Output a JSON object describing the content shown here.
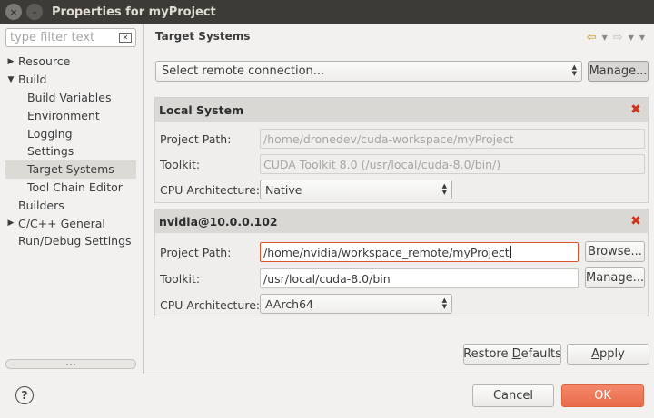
{
  "window": {
    "title": "Properties for myProject"
  },
  "filter": {
    "placeholder": "type filter text"
  },
  "tree": {
    "resource": "Resource",
    "build": "Build",
    "build_variables": "Build Variables",
    "environment": "Environment",
    "logging": "Logging",
    "settings": "Settings",
    "target_systems": "Target Systems",
    "tool_chain_editor": "Tool Chain Editor",
    "builders": "Builders",
    "cpp_general": "C/C++ General",
    "run_debug": "Run/Debug Settings"
  },
  "page": {
    "title": "Target Systems"
  },
  "remote": {
    "select_label": "Select remote connection...",
    "manage_label": "Manage..."
  },
  "local": {
    "header": "Local System",
    "project_path_label": "Project Path:",
    "project_path_value": "/home/dronedev/cuda-workspace/myProject",
    "toolkit_label": "Toolkit:",
    "toolkit_value": "CUDA Toolkit 8.0 (/usr/local/cuda-8.0/bin/)",
    "cpu_label": "CPU Architecture:",
    "cpu_value": "Native"
  },
  "remote_system": {
    "header": "nvidia@10.0.0.102",
    "project_path_label": "Project Path:",
    "project_path_value": "/home/nvidia/workspace_remote/myProject",
    "browse_label": "Browse...",
    "toolkit_label": "Toolkit:",
    "toolkit_value": "/usr/local/cuda-8.0/bin",
    "manage_label": "Manage...",
    "cpu_label": "CPU Architecture:",
    "cpu_value": "AArch64"
  },
  "actions": {
    "restore_defaults_pre": "Restore ",
    "restore_defaults_mnemonic": "D",
    "restore_defaults_post": "efaults",
    "apply_mnemonic": "A",
    "apply_post": "pply",
    "cancel": "Cancel",
    "ok": "OK"
  },
  "colors": {
    "accent": "#ea6c4b",
    "delete": "#d0321c",
    "titlebar": "#3c3b37"
  }
}
